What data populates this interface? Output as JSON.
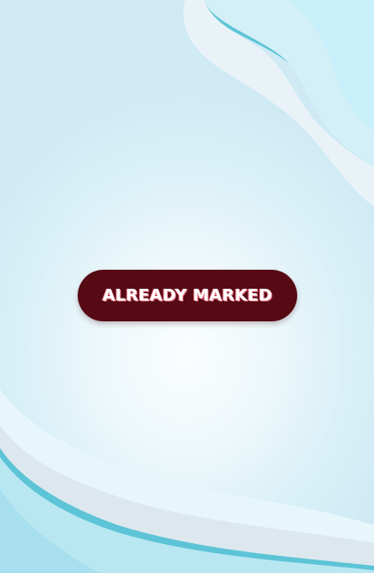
{
  "status_button": {
    "label": "ALREADY MARKED"
  },
  "colors": {
    "button_bg": "#560a14",
    "button_text": "#ffffff",
    "background": "#d9f0f7",
    "wave_accent": "#5cc4d6"
  }
}
